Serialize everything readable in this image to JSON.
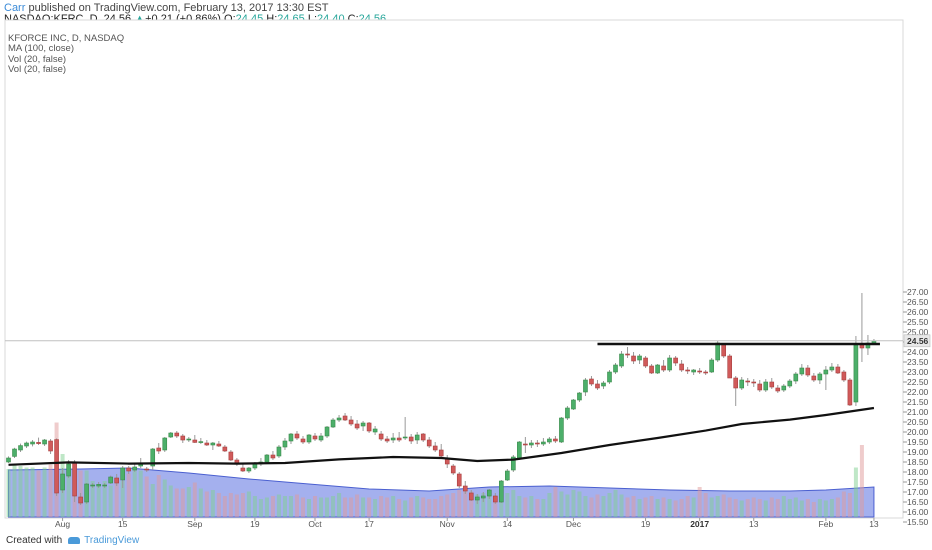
{
  "header": {
    "author": "Carr",
    "published_text": "published on TradingView.com, February 13, 2017 13:30 EST",
    "symbol_text": "NASDAQ:KFRC, D",
    "last": "24.56",
    "change_arrow": "▲",
    "change": "+0.21 (+0.86%)",
    "o_label": "O:",
    "o_value": "24.45",
    "h_label": "H:",
    "h_value": "24.65",
    "l_label": "L:",
    "l_value": "24.40",
    "c_label": "C:",
    "c_value": "24.56"
  },
  "legend": {
    "line1": "KFORCE INC, D, NASDAQ",
    "line2": "MA (100, close)",
    "line3": "Vol (20, false)",
    "line4": "Vol (20, false)"
  },
  "footer": {
    "created_with": "Created with",
    "brand": "TradingView"
  },
  "colors": {
    "up": "#4caf6a",
    "down": "#d05a5a",
    "ma": "#111111",
    "volume_area": "#5a6fe0",
    "resistance": "#111111",
    "last_price_line": "#c0c0c0"
  },
  "chart_data": {
    "type": "candlestick",
    "title": "KFORCE INC, D, NASDAQ",
    "xlabel": "",
    "ylabel": "",
    "ylim": [
      15.25,
      27.25
    ],
    "y_ticks": [
      "27.00",
      "26.50",
      "26.00",
      "25.50",
      "25.00",
      "24.50",
      "24.00",
      "23.50",
      "23.00",
      "22.50",
      "22.00",
      "21.50",
      "21.00",
      "20.50",
      "20.00",
      "19.50",
      "19.00",
      "18.50",
      "18.00",
      "17.50",
      "17.00",
      "16.50",
      "16.00",
      "15.50"
    ],
    "x_ticks": [
      {
        "label": "Aug",
        "i": 9,
        "bold": false
      },
      {
        "label": "15",
        "i": 19,
        "bold": false
      },
      {
        "label": "Sep",
        "i": 31,
        "bold": false
      },
      {
        "label": "19",
        "i": 41,
        "bold": false
      },
      {
        "label": "Oct",
        "i": 51,
        "bold": false
      },
      {
        "label": "17",
        "i": 60,
        "bold": false
      },
      {
        "label": "Nov",
        "i": 73,
        "bold": false
      },
      {
        "label": "14",
        "i": 83,
        "bold": false
      },
      {
        "label": "Dec",
        "i": 94,
        "bold": false
      },
      {
        "label": "19",
        "i": 106,
        "bold": false
      },
      {
        "label": "2017",
        "i": 115,
        "bold": true
      },
      {
        "label": "13",
        "i": 124,
        "bold": false
      },
      {
        "label": "Feb",
        "i": 136,
        "bold": false
      },
      {
        "label": "13",
        "i": 144,
        "bold": false
      }
    ],
    "last_price": "24.56",
    "resistance_level": 24.4,
    "candles": [
      [
        18.5,
        18.78,
        18.45,
        18.7
      ],
      [
        18.78,
        19.21,
        18.7,
        19.15
      ],
      [
        19.1,
        19.42,
        19.0,
        19.32
      ],
      [
        19.3,
        19.52,
        19.2,
        19.45
      ],
      [
        19.4,
        19.6,
        19.28,
        19.5
      ],
      [
        19.48,
        19.72,
        19.35,
        19.42
      ],
      [
        19.4,
        19.65,
        19.3,
        19.6
      ],
      [
        19.55,
        19.65,
        18.9,
        19.05
      ],
      [
        19.62,
        19.68,
        16.8,
        16.95
      ],
      [
        17.1,
        18.2,
        16.95,
        17.9
      ],
      [
        17.8,
        18.6,
        17.7,
        18.4
      ],
      [
        18.45,
        18.6,
        16.5,
        16.8
      ],
      [
        16.75,
        16.95,
        16.35,
        16.45
      ],
      [
        16.5,
        17.45,
        16.4,
        17.4
      ],
      [
        17.35,
        17.45,
        17.2,
        17.35
      ],
      [
        17.3,
        17.5,
        17.2,
        17.38
      ],
      [
        17.32,
        17.45,
        17.2,
        17.35
      ],
      [
        17.45,
        17.82,
        17.4,
        17.75
      ],
      [
        17.7,
        17.9,
        17.3,
        17.45
      ],
      [
        17.6,
        18.3,
        17.2,
        18.2
      ],
      [
        18.2,
        18.3,
        17.9,
        18.05
      ],
      [
        18.1,
        18.4,
        18.0,
        18.25
      ],
      [
        18.3,
        18.7,
        18.2,
        18.45
      ],
      [
        18.15,
        18.25,
        18.0,
        18.1
      ],
      [
        18.3,
        19.2,
        18.1,
        19.15
      ],
      [
        19.2,
        19.45,
        18.9,
        19.05
      ],
      [
        19.1,
        19.75,
        19.0,
        19.7
      ],
      [
        19.75,
        20.0,
        19.7,
        19.95
      ],
      [
        19.95,
        20.05,
        19.7,
        19.8
      ],
      [
        19.8,
        19.9,
        19.45,
        19.6
      ],
      [
        19.6,
        19.75,
        19.5,
        19.65
      ],
      [
        19.6,
        19.85,
        19.45,
        19.48
      ],
      [
        19.5,
        19.7,
        19.4,
        19.52
      ],
      [
        19.45,
        19.6,
        19.3,
        19.35
      ],
      [
        19.35,
        19.5,
        19.1,
        19.45
      ],
      [
        19.4,
        19.55,
        19.25,
        19.3
      ],
      [
        19.25,
        19.35,
        19.0,
        19.05
      ],
      [
        19.0,
        19.1,
        18.55,
        18.6
      ],
      [
        18.6,
        18.7,
        18.3,
        18.4
      ],
      [
        18.2,
        18.45,
        18.0,
        18.05
      ],
      [
        18.05,
        18.25,
        17.95,
        18.2
      ],
      [
        18.2,
        18.5,
        18.1,
        18.45
      ],
      [
        18.4,
        18.7,
        18.3,
        18.5
      ],
      [
        18.5,
        18.9,
        18.45,
        18.85
      ],
      [
        18.85,
        19.05,
        18.6,
        18.7
      ],
      [
        18.8,
        19.35,
        18.7,
        19.25
      ],
      [
        19.25,
        19.7,
        19.1,
        19.55
      ],
      [
        19.55,
        19.95,
        19.4,
        19.9
      ],
      [
        19.9,
        20.05,
        19.6,
        19.7
      ],
      [
        19.65,
        19.8,
        19.4,
        19.5
      ],
      [
        19.5,
        19.9,
        19.4,
        19.85
      ],
      [
        19.8,
        19.95,
        19.55,
        19.65
      ],
      [
        19.6,
        19.95,
        19.5,
        19.8
      ],
      [
        19.8,
        20.3,
        19.7,
        20.25
      ],
      [
        20.25,
        20.7,
        20.2,
        20.6
      ],
      [
        20.6,
        20.85,
        20.5,
        20.7
      ],
      [
        20.8,
        20.95,
        20.55,
        20.6
      ],
      [
        20.6,
        20.8,
        20.3,
        20.4
      ],
      [
        20.4,
        20.6,
        20.1,
        20.2
      ],
      [
        20.3,
        20.55,
        20.05,
        20.45
      ],
      [
        20.45,
        20.5,
        19.95,
        20.05
      ],
      [
        20.0,
        20.3,
        19.85,
        20.15
      ],
      [
        19.9,
        20.05,
        19.55,
        19.65
      ],
      [
        19.65,
        19.8,
        19.45,
        19.55
      ],
      [
        19.6,
        19.95,
        19.45,
        19.7
      ],
      [
        19.7,
        20.0,
        19.5,
        19.6
      ],
      [
        19.7,
        20.75,
        19.6,
        19.75
      ],
      [
        19.75,
        19.9,
        19.4,
        19.55
      ],
      [
        19.6,
        20.0,
        19.4,
        19.85
      ],
      [
        19.9,
        19.95,
        19.5,
        19.6
      ],
      [
        19.6,
        19.75,
        19.2,
        19.3
      ],
      [
        19.3,
        19.5,
        19.0,
        19.1
      ],
      [
        19.1,
        19.4,
        18.7,
        18.8
      ],
      [
        18.7,
        18.85,
        18.2,
        18.4
      ],
      [
        18.3,
        18.4,
        17.85,
        17.95
      ],
      [
        17.9,
        18.0,
        17.2,
        17.3
      ],
      [
        17.3,
        17.55,
        16.9,
        17.05
      ],
      [
        16.95,
        17.1,
        16.55,
        16.6
      ],
      [
        16.6,
        16.9,
        16.4,
        16.75
      ],
      [
        16.7,
        17.0,
        16.5,
        16.8
      ],
      [
        16.8,
        17.15,
        16.65,
        17.1
      ],
      [
        16.8,
        16.95,
        16.4,
        16.5
      ],
      [
        16.5,
        17.6,
        16.45,
        17.55
      ],
      [
        17.6,
        18.15,
        17.55,
        18.05
      ],
      [
        18.1,
        18.85,
        18.0,
        18.75
      ],
      [
        18.7,
        19.55,
        18.6,
        19.5
      ],
      [
        19.4,
        19.75,
        18.95,
        19.35
      ],
      [
        19.35,
        19.6,
        19.2,
        19.45
      ],
      [
        19.45,
        19.6,
        19.25,
        19.4
      ],
      [
        19.4,
        19.7,
        19.3,
        19.5
      ],
      [
        19.5,
        19.75,
        19.4,
        19.65
      ],
      [
        19.65,
        19.8,
        19.45,
        19.55
      ],
      [
        19.5,
        20.75,
        19.45,
        20.7
      ],
      [
        20.7,
        21.3,
        20.6,
        21.2
      ],
      [
        21.15,
        21.65,
        21.1,
        21.6
      ],
      [
        21.6,
        22.0,
        21.5,
        21.95
      ],
      [
        22.0,
        22.7,
        21.8,
        22.6
      ],
      [
        22.65,
        22.8,
        22.3,
        22.4
      ],
      [
        22.4,
        22.6,
        22.1,
        22.2
      ],
      [
        22.3,
        22.55,
        22.15,
        22.45
      ],
      [
        22.5,
        23.1,
        22.4,
        23.0
      ],
      [
        23.0,
        23.45,
        22.9,
        23.35
      ],
      [
        23.3,
        24.05,
        23.2,
        23.9
      ],
      [
        23.9,
        24.25,
        23.7,
        23.85
      ],
      [
        23.8,
        24.0,
        23.4,
        23.55
      ],
      [
        23.6,
        23.9,
        23.4,
        23.8
      ],
      [
        23.7,
        23.8,
        23.2,
        23.3
      ],
      [
        23.3,
        23.4,
        22.9,
        22.95
      ],
      [
        22.95,
        23.4,
        22.9,
        23.35
      ],
      [
        23.3,
        23.6,
        23.0,
        23.1
      ],
      [
        23.1,
        23.85,
        23.0,
        23.7
      ],
      [
        23.7,
        23.8,
        23.3,
        23.45
      ],
      [
        23.4,
        23.6,
        23.0,
        23.1
      ],
      [
        23.1,
        23.25,
        22.9,
        23.05
      ],
      [
        23.0,
        23.15,
        22.85,
        23.1
      ],
      [
        23.05,
        23.2,
        22.9,
        23.0
      ],
      [
        23.0,
        23.1,
        22.85,
        22.95
      ],
      [
        23.0,
        23.7,
        22.95,
        23.6
      ],
      [
        23.6,
        24.55,
        23.5,
        24.45
      ],
      [
        24.4,
        24.45,
        23.7,
        23.8
      ],
      [
        23.8,
        23.9,
        22.7,
        22.7
      ],
      [
        22.7,
        22.8,
        21.3,
        22.2
      ],
      [
        22.2,
        22.75,
        22.1,
        22.6
      ],
      [
        22.55,
        22.7,
        22.3,
        22.5
      ],
      [
        22.5,
        22.65,
        22.25,
        22.45
      ],
      [
        22.4,
        22.6,
        22.0,
        22.1
      ],
      [
        22.1,
        22.65,
        22.0,
        22.5
      ],
      [
        22.5,
        22.7,
        22.15,
        22.25
      ],
      [
        22.2,
        22.35,
        21.95,
        22.05
      ],
      [
        22.1,
        22.4,
        22.0,
        22.3
      ],
      [
        22.3,
        22.65,
        22.2,
        22.55
      ],
      [
        22.55,
        23.0,
        22.4,
        22.9
      ],
      [
        22.9,
        23.4,
        22.8,
        23.2
      ],
      [
        23.2,
        23.35,
        22.75,
        22.85
      ],
      [
        22.8,
        22.95,
        22.5,
        22.6
      ],
      [
        22.6,
        23.0,
        22.4,
        22.9
      ],
      [
        22.9,
        23.3,
        22.1,
        23.1
      ],
      [
        23.1,
        23.45,
        23.0,
        23.25
      ],
      [
        23.25,
        23.4,
        22.9,
        22.95
      ],
      [
        23.0,
        23.1,
        22.5,
        22.6
      ],
      [
        22.6,
        22.7,
        21.3,
        21.35
      ],
      [
        21.5,
        24.8,
        21.3,
        24.35
      ],
      [
        24.35,
        26.95,
        23.5,
        24.2
      ],
      [
        24.2,
        24.85,
        23.85,
        24.45
      ],
      [
        24.45,
        24.65,
        24.4,
        24.56
      ]
    ],
    "volume": [
      32,
      35,
      34,
      33,
      33,
      31,
      33,
      35,
      63,
      42,
      34,
      37,
      31,
      31,
      24,
      22,
      24,
      21,
      23,
      24,
      29,
      32,
      31,
      27,
      22,
      28,
      25,
      21,
      19,
      19,
      20,
      23,
      19,
      17,
      18,
      16,
      14,
      16,
      15,
      16,
      17,
      14,
      12,
      13,
      14,
      15,
      14,
      14,
      15,
      13,
      12,
      14,
      13,
      13,
      14,
      16,
      13,
      13,
      15,
      13,
      13,
      12,
      14,
      13,
      14,
      12,
      11,
      13,
      14,
      13,
      12,
      12,
      14,
      15,
      16,
      18,
      20,
      17,
      15,
      16,
      14,
      13,
      15,
      16,
      18,
      14,
      13,
      14,
      12,
      12,
      16,
      20,
      17,
      15,
      18,
      17,
      14,
      13,
      15,
      14,
      16,
      18,
      15,
      13,
      14,
      12,
      13,
      14,
      12,
      13,
      12,
      11,
      12,
      14,
      13,
      20,
      16,
      13,
      14,
      15,
      13,
      12,
      11,
      12,
      13,
      12,
      11,
      13,
      12,
      14,
      12,
      13,
      11,
      12,
      10,
      12,
      11,
      12,
      13,
      17,
      16,
      33,
      48
    ],
    "ma": [
      [
        0,
        18.36
      ],
      [
        10,
        18.48
      ],
      [
        20,
        18.42
      ],
      [
        30,
        18.45
      ],
      [
        38,
        18.42
      ],
      [
        46,
        18.45
      ],
      [
        55,
        18.63
      ],
      [
        64,
        18.75
      ],
      [
        72,
        18.7
      ],
      [
        78,
        18.55
      ],
      [
        84,
        18.62
      ],
      [
        92,
        18.95
      ],
      [
        100,
        19.35
      ],
      [
        108,
        19.7
      ],
      [
        116,
        20.07
      ],
      [
        122,
        20.4
      ],
      [
        130,
        20.62
      ],
      [
        136,
        20.85
      ],
      [
        144,
        21.2
      ]
    ],
    "volume_ma": [
      [
        0,
        47
      ],
      [
        12,
        48
      ],
      [
        20,
        49
      ],
      [
        30,
        44
      ],
      [
        40,
        38
      ],
      [
        50,
        33
      ],
      [
        60,
        28
      ],
      [
        70,
        26
      ],
      [
        80,
        30
      ],
      [
        90,
        31
      ],
      [
        100,
        29
      ],
      [
        110,
        27
      ],
      [
        120,
        26
      ],
      [
        130,
        26
      ],
      [
        136,
        27
      ],
      [
        144,
        30
      ]
    ]
  }
}
